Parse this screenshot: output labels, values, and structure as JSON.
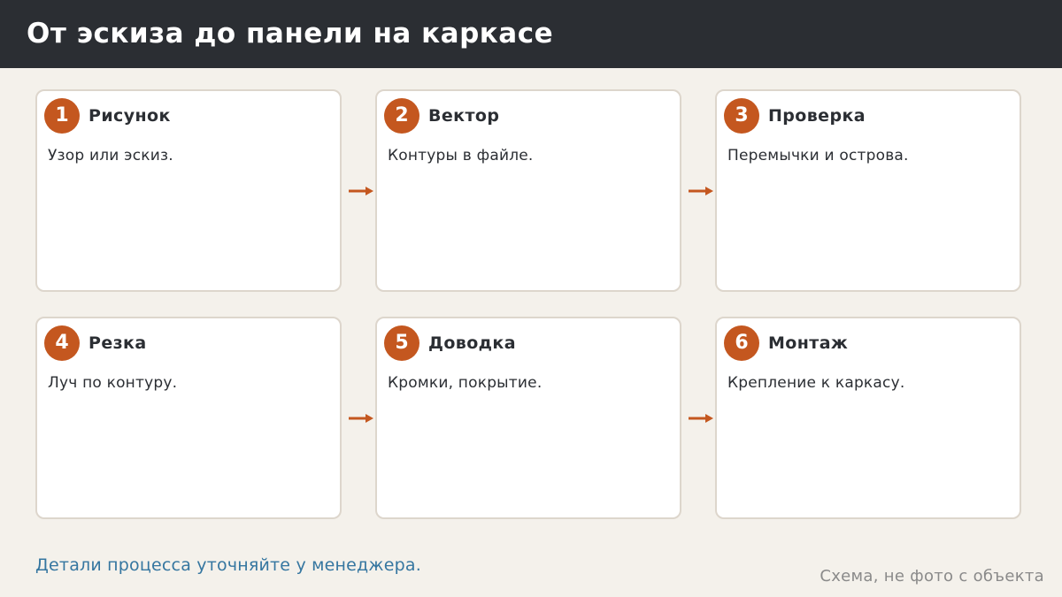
{
  "header": {
    "title": "От эскиза до панели на каркасе"
  },
  "steps": [
    {
      "number": "1",
      "title": "Рисунок",
      "description": "Узор или эскиз."
    },
    {
      "number": "2",
      "title": "Вектор",
      "description": "Контуры в файле."
    },
    {
      "number": "3",
      "title": "Проверка",
      "description": "Перемычки и острова."
    },
    {
      "number": "4",
      "title": "Резка",
      "description": "Луч по контуру."
    },
    {
      "number": "5",
      "title": "Доводка",
      "description": "Кромки, покрытие."
    },
    {
      "number": "6",
      "title": "Монтаж",
      "description": "Крепление к каркасу."
    }
  ],
  "footer": {
    "note": "Детали процесса уточняйте у менеджера.",
    "caption": "Схема, не фото с объекта"
  },
  "colors": {
    "header_bg": "#2b2e33",
    "accent": "#c4571f",
    "page_bg": "#f4f1eb",
    "card_border": "#ddd6cc",
    "link": "#3576a0",
    "caption": "#8a8a8a"
  }
}
